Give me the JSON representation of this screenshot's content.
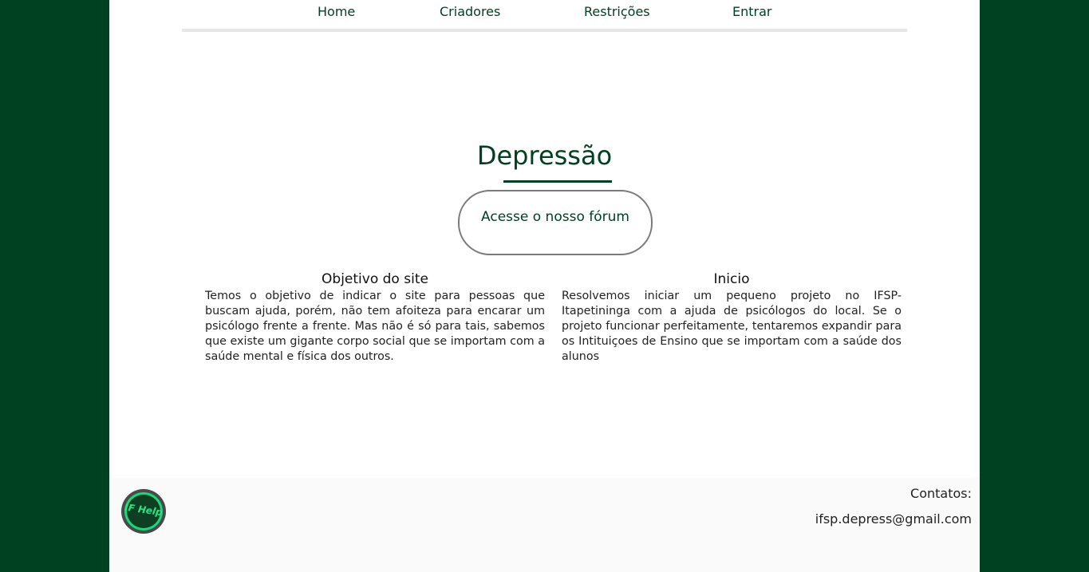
{
  "nav": {
    "items": [
      "Home",
      "Criadores",
      "Restrições",
      "Entrar"
    ]
  },
  "main": {
    "title": "Depressão",
    "forum_button": "Acesse o nosso fórum",
    "sections": [
      {
        "heading": "Objetivo do site",
        "text": "Temos o objetivo de indicar o site para pessoas que buscam ajuda, porém, não tem afoiteza para encarar um psicólogo frente a frente. Mas não é só para tais, sabemos que existe um gigante corpo social que se importam com a saúde mental e física dos outros."
      },
      {
        "heading": "Inicio",
        "text": "Resolvemos iniciar um pequeno projeto no IFSP-Itapetininga com a ajuda de psicólogos do local. Se o projeto funcionar perfeitamente, tentaremos expandir para os Intituiçoes de Ensino que se importam com a saúde dos alunos"
      }
    ]
  },
  "footer": {
    "logo_text": "IF Help",
    "contact_label": "Contatos:",
    "contact_email": "ifsp.depress@gmail.com"
  },
  "colors": {
    "brand_green": "#004121",
    "logo_accent": "#1ee887",
    "footer_bg": "#fafafa"
  }
}
